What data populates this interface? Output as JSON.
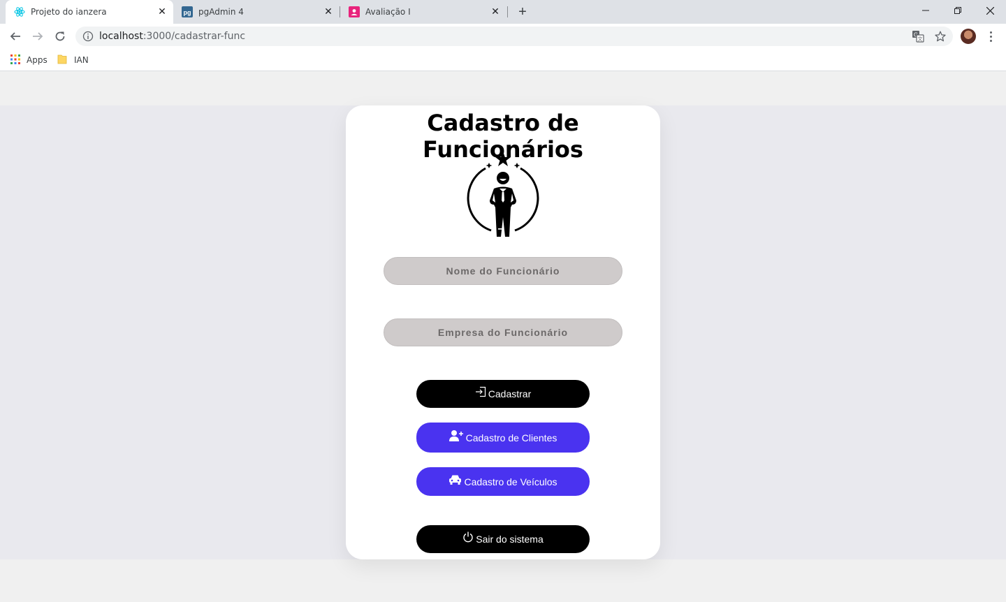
{
  "browser": {
    "tabs": [
      {
        "title": "Projeto do ianzera",
        "active": true,
        "favicon": "react-icon"
      },
      {
        "title": "pgAdmin 4",
        "active": false,
        "favicon": "pgadmin-icon"
      },
      {
        "title": "Avaliação I",
        "active": false,
        "favicon": "classroom-icon"
      }
    ],
    "url_host": "localhost",
    "url_path": ":3000/cadastrar-func",
    "bookmarks": [
      {
        "label": "Apps",
        "icon": "apps-grid-icon"
      },
      {
        "label": "IAN",
        "icon": "folder-icon"
      }
    ]
  },
  "page": {
    "title": "Cadastro de Funcionários",
    "illustration": "employee-star-icon",
    "fields": {
      "name_placeholder": "Nome do Funcionário",
      "company_placeholder": "Empresa do Funcionário"
    },
    "buttons": {
      "register": "Cadastrar",
      "clients": "Cadastro de Clientes",
      "vehicles": "Cadastro de Veículos",
      "logout": "Sair do sistema"
    }
  },
  "colors": {
    "primary_blue": "#4a33f0",
    "black": "#000000",
    "input_bg": "#cfcbcb",
    "page_bg": "#e9e9ee"
  }
}
